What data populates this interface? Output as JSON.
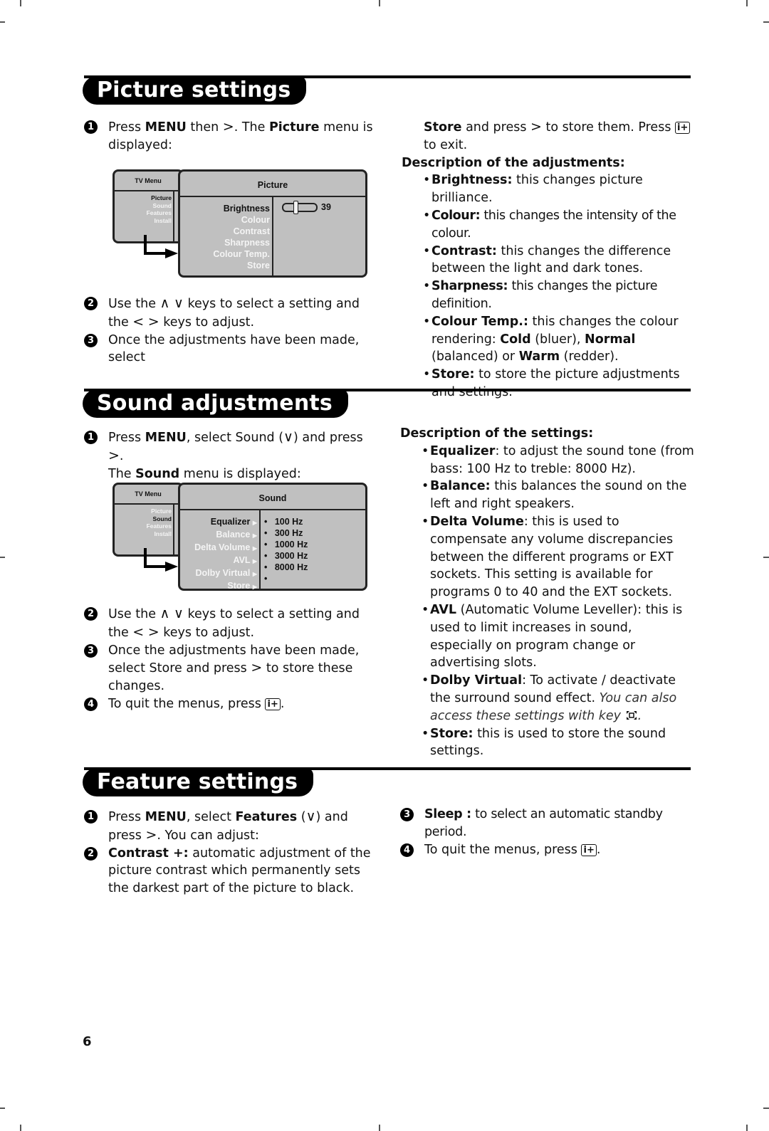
{
  "picture": {
    "title": "Picture settings",
    "step1_a": "Press ",
    "step1_menu": "MENU",
    "step1_b": " then ",
    "step1_c": ". The ",
    "step1_picture": "Picture",
    "step1_d": " menu is displayed:",
    "step2_a": "Use the ",
    "step2_b": " keys to select a setting and the ",
    "step2_c": " keys to adjust.",
    "step3_a": "Once the adjustments have been made, select ",
    "step3_store": "Store",
    "step3_b": " and press ",
    "step3_c": " to store them. Press ",
    "step3_d": " to exit.",
    "desc_heading": "Description of the adjustments:",
    "descriptions": [
      {
        "term": "Brightness:",
        "text": " this changes picture brilliance."
      },
      {
        "term": "Colour:",
        "text": " this changes the intensity of the colour."
      },
      {
        "term": "Contrast:",
        "text": " this changes the difference between the light and dark tones."
      },
      {
        "term": "Sharpness:",
        "text": " this changes the picture definition."
      },
      {
        "term": "Colour Temp.:",
        "text": " this changes the colour rendering: ",
        "cold": "Cold",
        "t1": " (bluer), ",
        "normal": "Normal",
        "t2": " (balanced) or ",
        "warm": "Warm",
        "t3": " (redder)."
      },
      {
        "term": "Store:",
        "text": " to store the picture adjustments and settings."
      }
    ],
    "menu": {
      "tv_menu_label": "TV Menu",
      "left_items": [
        "Picture",
        "Sound",
        "Features",
        "Install"
      ],
      "active_left": "Picture",
      "header": "Picture",
      "items": [
        "Brightness",
        "Colour",
        "Contrast",
        "Sharpness",
        "Colour Temp.",
        "Store"
      ],
      "active_item": "Brightness",
      "brightness_value": "39"
    }
  },
  "sound": {
    "title": "Sound adjustments",
    "step1_a": "Press ",
    "step1_menu": "MENU",
    "step1_b": ", select Sound (",
    "step1_c": ") and press ",
    "step1_d": ".",
    "step1_e": "The ",
    "step1_sound": "Sound",
    "step1_f": " menu is displayed:",
    "step2_a": "Use the ",
    "step2_b": " keys to select a setting and the ",
    "step2_c": " keys to adjust.",
    "step3": "Once the adjustments have been made, select Store and press ",
    "step3_b": " to store these changes.",
    "step4": "To quit the menus, press ",
    "step4_b": ".",
    "desc_heading": "Description of the settings:",
    "descriptions": [
      {
        "term": "Equalizer",
        "text": ": to adjust the sound tone (from bass: 100 Hz to treble: 8000 Hz)."
      },
      {
        "term": "Balance:",
        "text": " this balances the sound on the left and right speakers."
      },
      {
        "term": "Delta Volume",
        "text": ": this is used to compensate any volume discrepancies between the different programs or EXT sockets. This setting is available for programs 0 to 40 and the EXT sockets."
      },
      {
        "term": "AVL",
        "text": " (Automatic Volume Leveller): this is used to limit increases in sound, especially on program change or advertising slots."
      },
      {
        "term": "Dolby Virtual",
        "text": ": To activate / deactivate the surround sound effect.",
        "italic": "You can also access these settings with key",
        "italic_end": "."
      },
      {
        "term": "Store:",
        "text": " this is used to store the sound settings."
      }
    ],
    "menu": {
      "tv_menu_label": "TV Menu",
      "left_items": [
        "Picture",
        "Sound",
        "Features",
        "Install"
      ],
      "active_left": "Sound",
      "header": "Sound",
      "items": [
        "Equalizer",
        "Balance",
        "Delta Volume",
        "AVL",
        "Dolby Virtual",
        "Store"
      ],
      "active_item": "Equalizer",
      "values": [
        "100 Hz",
        "300 Hz",
        "1000 Hz",
        "3000 Hz",
        "8000 Hz",
        ""
      ]
    }
  },
  "features": {
    "title": "Feature settings",
    "step1_a": "Press ",
    "step1_menu": "MENU",
    "step1_b": ", select ",
    "step1_features": "Features",
    "step1_c": " (",
    "step1_d": ") and press ",
    "step1_e": ". You can adjust:",
    "step2_term": "Contrast +:",
    "step2_text": " automatic adjustment of the picture contrast which permanently sets the darkest part of the picture to black.",
    "step3_term": "Sleep :",
    "step3_text": " to select an automatic standby period.",
    "step4": "To quit the menus, press ",
    "step4_b": "."
  },
  "symbols": {
    "right": ">",
    "left": "<",
    "up": "∧",
    "down": "∨",
    "info_key": "i+",
    "bullet": "•",
    "arrow": "▶"
  },
  "step_numbers": [
    "1",
    "2",
    "3",
    "4"
  ],
  "page_number": "6"
}
